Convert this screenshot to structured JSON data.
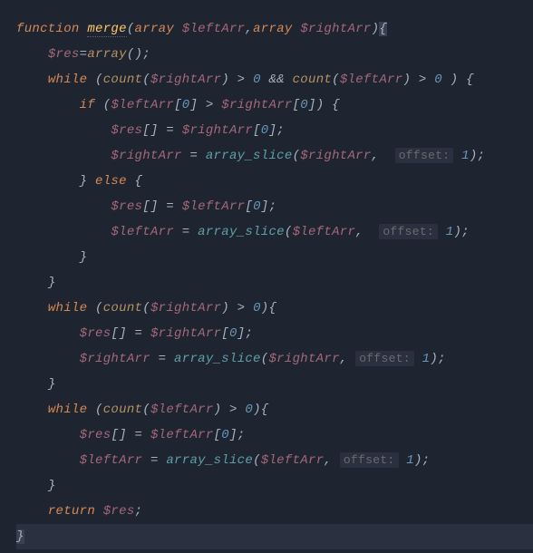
{
  "code": {
    "l1_kw": "function",
    "l1_fn": "merge",
    "l1_lp": "(",
    "l1_t1": "array",
    "l1_v1": "$leftArr",
    "l1_c": ",",
    "l1_t2": "array",
    "l1_v2": "$rightArr",
    "l1_rp": ")",
    "l1_ob": "{",
    "l2_v": "$res",
    "l2_eq": "=",
    "l2_fn": "array",
    "l2_pp": "();",
    "l3_kw": "while",
    "l3_lp": "(",
    "l3_fn1": "count",
    "l3_lp1": "(",
    "l3_v1": "$rightArr",
    "l3_rp1": ")",
    "l3_op1": ">",
    "l3_n1": "0",
    "l3_and": "&&",
    "l3_fn2": "count",
    "l3_lp2": "(",
    "l3_v2": "$leftArr",
    "l3_rp2": ")",
    "l3_op2": ">",
    "l3_n2": "0",
    "l3_rp": ")",
    "l3_ob": "{",
    "l4_kw": "if",
    "l4_lp": "(",
    "l4_v1": "$leftArr",
    "l4_lb": "[",
    "l4_n1": "0",
    "l4_rb": "]",
    "l4_op": ">",
    "l4_v2": "$rightArr",
    "l4_lb2": "[",
    "l4_n2": "0",
    "l4_rb2": "]",
    "l4_rp": ")",
    "l4_ob": "{",
    "l5_v1": "$res",
    "l5_br": "[]",
    "l5_eq": "=",
    "l5_v2": "$rightArr",
    "l5_lb": "[",
    "l5_n": "0",
    "l5_rb": "]",
    "l5_sc": ";",
    "l6_v1": "$rightArr",
    "l6_eq": "=",
    "l6_fn": "array_slice",
    "l6_lp": "(",
    "l6_v2": "$rightArr",
    "l6_c": ",",
    "l6_hint": "offset:",
    "l6_n": "1",
    "l6_rp": ")",
    "l6_sc": ";",
    "l7_cb": "}",
    "l7_kw": "else",
    "l7_ob": "{",
    "l8_v1": "$res",
    "l8_br": "[]",
    "l8_eq": "=",
    "l8_v2": "$leftArr",
    "l8_lb": "[",
    "l8_n": "0",
    "l8_rb": "]",
    "l8_sc": ";",
    "l9_v1": "$leftArr",
    "l9_eq": "=",
    "l9_fn": "array_slice",
    "l9_lp": "(",
    "l9_v2": "$leftArr",
    "l9_c": ",",
    "l9_hint": "offset:",
    "l9_n": "1",
    "l9_rp": ")",
    "l9_sc": ";",
    "l10_cb": "}",
    "l11_cb": "}",
    "l12_kw": "while",
    "l12_lp": "(",
    "l12_fn": "count",
    "l12_lp1": "(",
    "l12_v": "$rightArr",
    "l12_rp1": ")",
    "l12_op": ">",
    "l12_n": "0",
    "l12_rp": ")",
    "l12_ob": "{",
    "l13_v1": "$res",
    "l13_br": "[]",
    "l13_eq": "=",
    "l13_v2": "$rightArr",
    "l13_lb": "[",
    "l13_n": "0",
    "l13_rb": "]",
    "l13_sc": ";",
    "l14_v1": "$rightArr",
    "l14_eq": "=",
    "l14_fn": "array_slice",
    "l14_lp": "(",
    "l14_v2": "$rightArr",
    "l14_c": ",",
    "l14_hint": "offset:",
    "l14_n": "1",
    "l14_rp": ")",
    "l14_sc": ";",
    "l15_cb": "}",
    "l16_kw": "while",
    "l16_lp": "(",
    "l16_fn": "count",
    "l16_lp1": "(",
    "l16_v": "$leftArr",
    "l16_rp1": ")",
    "l16_op": ">",
    "l16_n": "0",
    "l16_rp": ")",
    "l16_ob": "{",
    "l17_v1": "$res",
    "l17_br": "[]",
    "l17_eq": "=",
    "l17_v2": "$leftArr",
    "l17_lb": "[",
    "l17_n": "0",
    "l17_rb": "]",
    "l17_sc": ";",
    "l18_v1": "$leftArr",
    "l18_eq": "=",
    "l18_fn": "array_slice",
    "l18_lp": "(",
    "l18_v2": "$leftArr",
    "l18_c": ",",
    "l18_hint": "offset:",
    "l18_n": "1",
    "l18_rp": ")",
    "l18_sc": ";",
    "l19_cb": "}",
    "l20_kw": "return",
    "l20_v": "$res",
    "l20_sc": ";",
    "l21_cb": "}"
  }
}
